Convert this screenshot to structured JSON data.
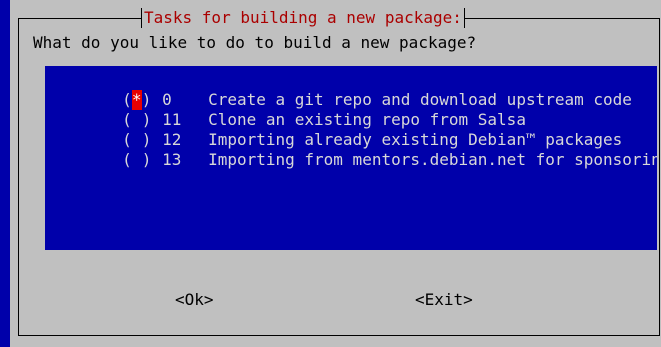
{
  "dialog": {
    "title": "Tasks for building a new package:",
    "prompt": "What do you like to do to build a new package?"
  },
  "options": [
    {
      "selected": true,
      "mark": "*",
      "number": "0",
      "label": "Create a git repo and download upstream code"
    },
    {
      "selected": false,
      "mark": " ",
      "number": "11",
      "label": "Clone an existing repo from Salsa"
    },
    {
      "selected": false,
      "mark": " ",
      "number": "12",
      "label": "Importing already existing Debian™ packages"
    },
    {
      "selected": false,
      "mark": " ",
      "number": "13",
      "label": "Importing from mentors.debian.net for sponsoring"
    }
  ],
  "buttons": {
    "ok_label": "<Ok>",
    "exit_label": "<Exit>"
  },
  "colors": {
    "screen_bg": "#0000aa",
    "dialog_bg": "#c0c0c0",
    "title_text": "#aa0000",
    "selection_mark_bg": "#e80000"
  }
}
